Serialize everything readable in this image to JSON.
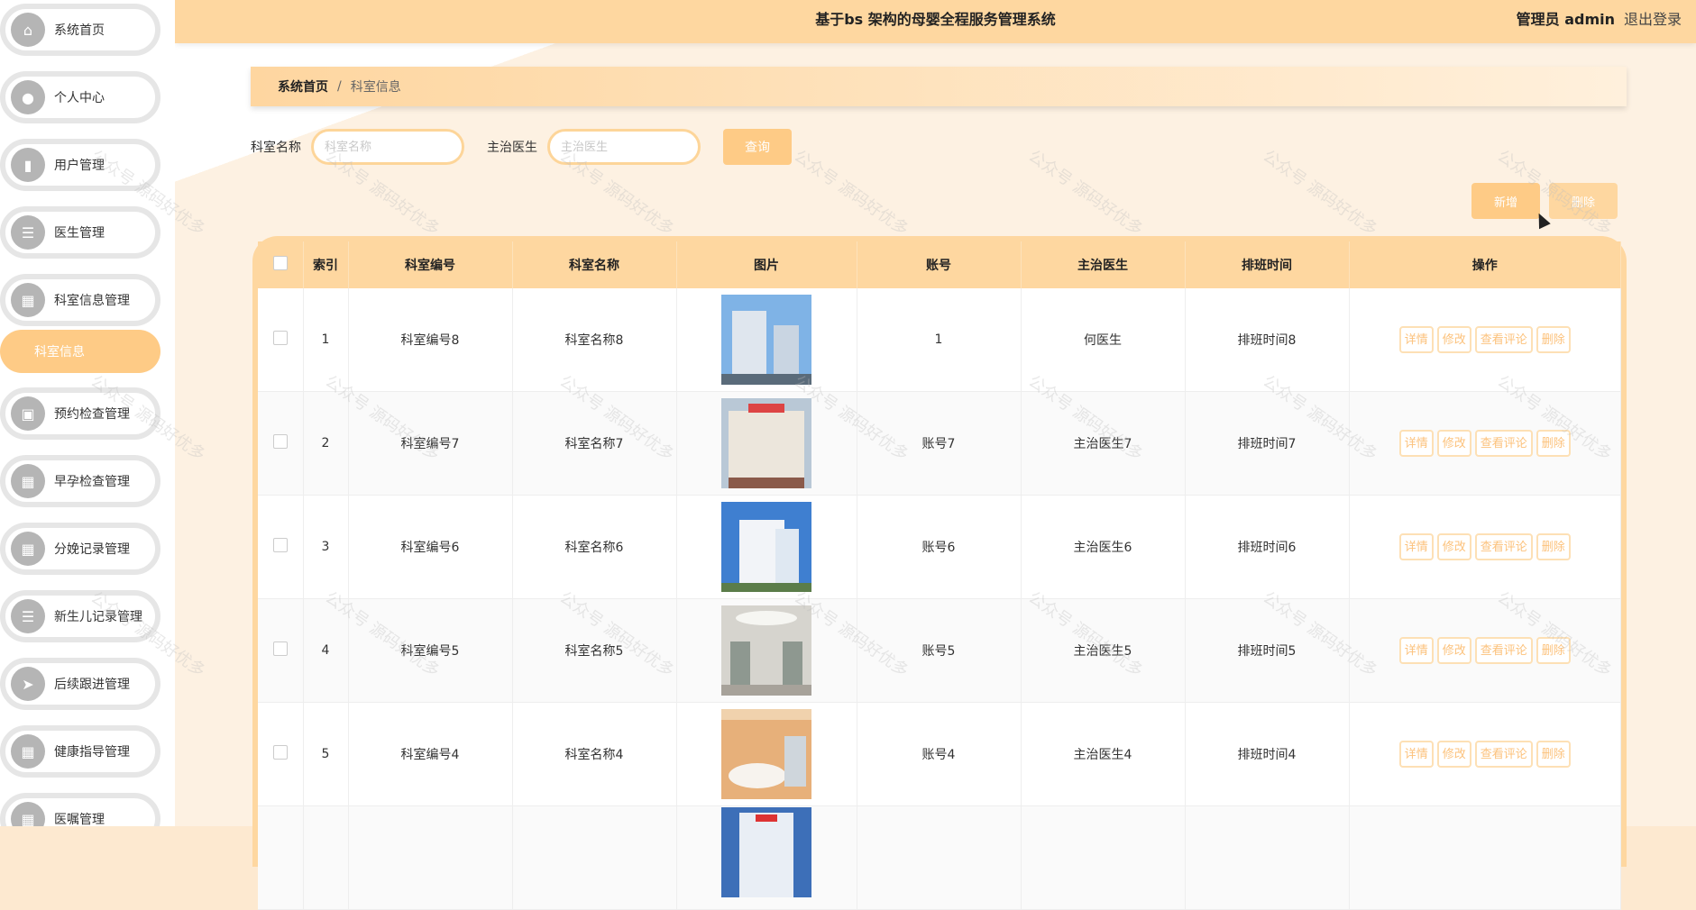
{
  "header": {
    "title": "基于bs 架构的母婴全程服务管理系统",
    "admin": "管理员 admin",
    "logout": "退出登录"
  },
  "sidebar": {
    "items": [
      {
        "label": "系统首页",
        "icon": "home-icon"
      },
      {
        "label": "个人中心",
        "icon": "user-icon"
      },
      {
        "label": "用户管理",
        "icon": "chat-icon"
      },
      {
        "label": "医生管理",
        "icon": "list-icon"
      },
      {
        "label": "科室信息管理",
        "icon": "grid-icon"
      },
      {
        "label": "预约检查管理",
        "icon": "doc-icon"
      },
      {
        "label": "早孕检查管理",
        "icon": "grid-icon"
      },
      {
        "label": "分娩记录管理",
        "icon": "grid-icon"
      },
      {
        "label": "新生儿记录管理",
        "icon": "list-icon"
      },
      {
        "label": "后续跟进管理",
        "icon": "send-icon"
      },
      {
        "label": "健康指导管理",
        "icon": "grid-icon"
      },
      {
        "label": "医嘱管理",
        "icon": "grid-icon"
      }
    ],
    "active_sub": "科室信息"
  },
  "breadcrumb": {
    "home": "系统首页",
    "sep": "/",
    "current": "科室信息"
  },
  "search": {
    "name_label": "科室名称",
    "name_placeholder": "科室名称",
    "doctor_label": "主治医生",
    "doctor_placeholder": "主治医生",
    "query_button": "查询"
  },
  "actions": {
    "add": "新增",
    "delete": "删除"
  },
  "table": {
    "columns": [
      "",
      "索引",
      "科室编号",
      "科室名称",
      "图片",
      "账号",
      "主治医生",
      "排班时间",
      "操作"
    ],
    "rows": [
      {
        "index": "1",
        "code": "科室编号8",
        "name": "科室名称8",
        "account": "1",
        "doctor": "何医生",
        "schedule": "排班时间8"
      },
      {
        "index": "2",
        "code": "科室编号7",
        "name": "科室名称7",
        "account": "账号7",
        "doctor": "主治医生7",
        "schedule": "排班时间7"
      },
      {
        "index": "3",
        "code": "科室编号6",
        "name": "科室名称6",
        "account": "账号6",
        "doctor": "主治医生6",
        "schedule": "排班时间6"
      },
      {
        "index": "4",
        "code": "科室编号5",
        "name": "科室名称5",
        "account": "账号5",
        "doctor": "主治医生5",
        "schedule": "排班时间5"
      },
      {
        "index": "5",
        "code": "科室编号4",
        "name": "科室名称4",
        "account": "账号4",
        "doctor": "主治医生4",
        "schedule": "排班时间4"
      }
    ],
    "ops": {
      "detail": "详情",
      "edit": "修改",
      "comments": "查看评论",
      "delete": "删除"
    }
  },
  "watermark": "公众号 源码好优多",
  "colors": {
    "accent": "#fecb86",
    "header": "#fed7a0",
    "op_text": "#fcc27c"
  }
}
